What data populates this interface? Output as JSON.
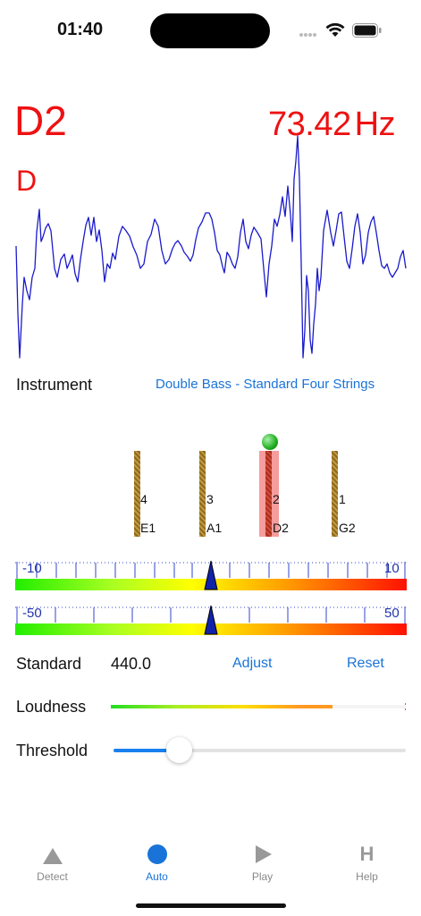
{
  "status": {
    "time": "01:40"
  },
  "detected": {
    "note": "D2",
    "note_name": "D",
    "frequency": "73.42",
    "unit": "Hz"
  },
  "instrument": {
    "label": "Instrument",
    "value": "Double Bass - Standard Four Strings"
  },
  "strings": [
    {
      "number": "4",
      "note": "E1",
      "active": false
    },
    {
      "number": "3",
      "note": "A1",
      "active": false
    },
    {
      "number": "2",
      "note": "D2",
      "active": true
    },
    {
      "number": "1",
      "note": "G2",
      "active": false
    }
  ],
  "meters": [
    {
      "min_label": "-10",
      "max_label": "10",
      "needle_fraction": 0.5
    },
    {
      "min_label": "-50",
      "max_label": "50",
      "needle_fraction": 0.5
    }
  ],
  "standard": {
    "label": "Standard",
    "value": "440.0",
    "adjust": "Adjust",
    "reset": "Reset"
  },
  "loudness": {
    "label": "Loudness",
    "level": 0.75
  },
  "threshold": {
    "label": "Threshold",
    "level": 0.22
  },
  "tabs": [
    {
      "label": "Detect",
      "icon": "triangle-icon",
      "active": false
    },
    {
      "label": "Auto",
      "icon": "circle-icon",
      "active": true
    },
    {
      "label": "Play",
      "icon": "play-icon",
      "active": false
    },
    {
      "label": "Help",
      "icon": "help-icon",
      "active": false
    }
  ],
  "colors": {
    "accent": "#1a73d8",
    "note": "#ee1111",
    "waveform": "#1a1acc",
    "string": "#b8862e"
  }
}
